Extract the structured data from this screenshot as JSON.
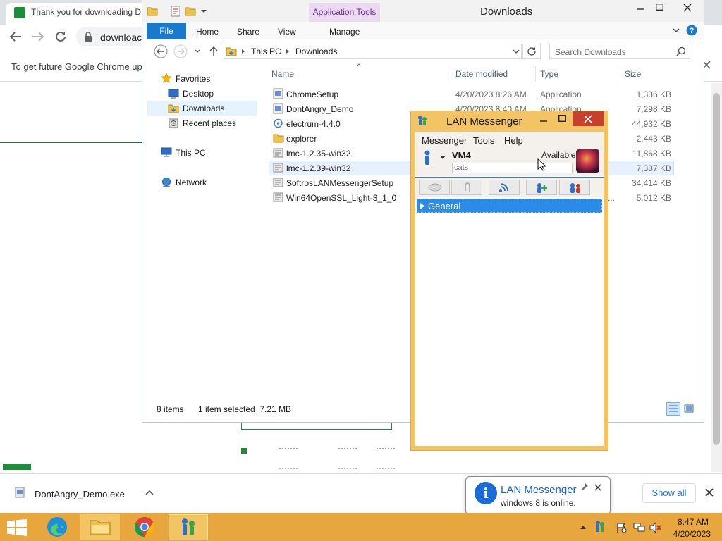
{
  "chrome": {
    "tab_title": "Thank you for downloading D",
    "url": "downloac",
    "infobar_text": "To get future Google Chrome up",
    "download_shelf": {
      "item_name": "DontAngry_Demo.exe",
      "show_all_label": "Show all"
    }
  },
  "explorer": {
    "title": "Downloads",
    "contextual_tab": "Application Tools",
    "ribbon_tabs": {
      "file": "File",
      "home": "Home",
      "share": "Share",
      "view": "View",
      "manage": "Manage"
    },
    "breadcrumb": [
      "This PC",
      "Downloads"
    ],
    "search_placeholder": "Search Downloads",
    "nav": {
      "favorites": "Favorites",
      "desktop": "Desktop",
      "downloads": "Downloads",
      "recent": "Recent places",
      "this_pc": "This PC",
      "network": "Network"
    },
    "columns": {
      "name": "Name",
      "date": "Date modified",
      "type": "Type",
      "size": "Size"
    },
    "files": [
      {
        "name": "ChromeSetup",
        "date": "4/20/2023 8:26 AM",
        "type": "Application",
        "size": "1,336 KB"
      },
      {
        "name": "DontAngry_Demo",
        "date": "4/20/2023 8:40 AM",
        "type": "Application",
        "size": "7,298 KB"
      },
      {
        "name": "electrum-4.4.0",
        "date": "",
        "type": "",
        "size": "44,932 KB"
      },
      {
        "name": "explorer",
        "date": "",
        "type": "",
        "size": "2,443 KB"
      },
      {
        "name": "lmc-1.2.35-win32",
        "date": "",
        "type": "",
        "size": "11,868 KB"
      },
      {
        "name": "lmc-1.2.39-win32",
        "date": "",
        "type": "",
        "size": "7,387 KB"
      },
      {
        "name": "SoftrosLANMessengerSetup",
        "date": "",
        "type": "",
        "size": "34,414 KB"
      },
      {
        "name": "Win64OpenSSL_Light-3_1_0",
        "date": "",
        "type": "...",
        "size": "5,012 KB"
      }
    ],
    "status": {
      "count": "8 items",
      "selection": "1 item selected  7.21 MB"
    }
  },
  "lan_messenger": {
    "title": "LAN Messenger",
    "menu": {
      "messenger": "Messenger",
      "tools": "Tools",
      "help": "Help"
    },
    "user_name": "VM4",
    "status": "Available",
    "note_value": "cats",
    "group_label": "General"
  },
  "notification": {
    "title": "LAN Messenger",
    "text": "windows 8 is online."
  },
  "taskbar": {
    "time": "8:47 AM",
    "date": "4/20/2023"
  },
  "colors": {
    "taskbar": "#e8a63e",
    "lm_frame": "#f2c464",
    "accent_blue": "#1979ca",
    "group_highlight": "#2b8ce8"
  }
}
